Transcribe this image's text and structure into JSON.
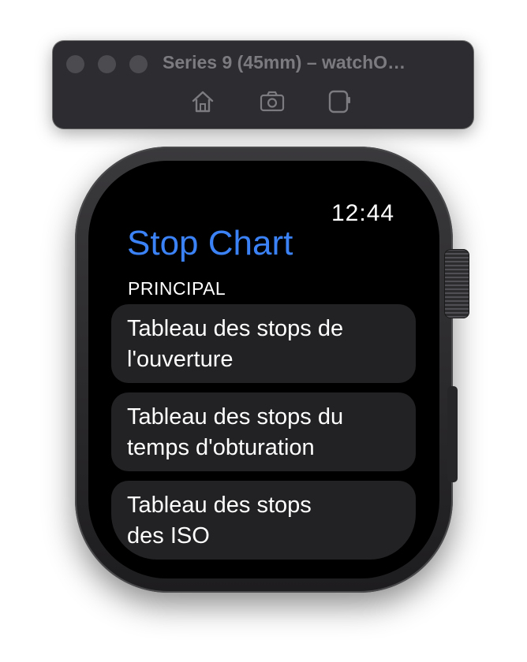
{
  "simulator": {
    "title": "Series 9 (45mm) – watchO…",
    "toolbar": [
      {
        "icon": "home-icon"
      },
      {
        "icon": "screenshot-icon"
      },
      {
        "icon": "rotate-device-icon"
      }
    ]
  },
  "watch": {
    "time": "12:44",
    "app_title": "Stop Chart",
    "section_header": "PRINCIPAL",
    "rows": [
      {
        "label": "Tableau des stops de l'ouverture"
      },
      {
        "label": "Tableau des stops du temps d'obturation"
      },
      {
        "label": "Tableau des stops des ISO"
      }
    ]
  },
  "colors": {
    "accent": "#3b82f6",
    "row_background": "#222224",
    "screen_background": "#000000"
  }
}
